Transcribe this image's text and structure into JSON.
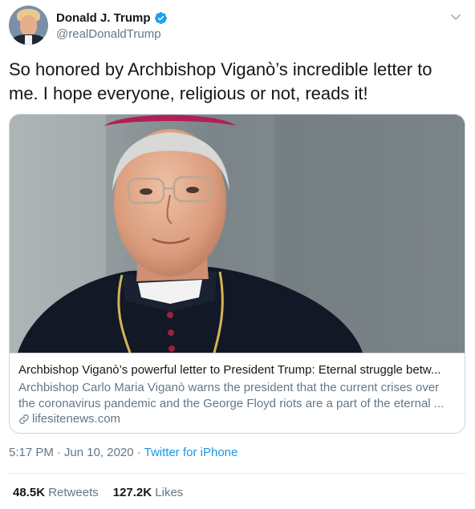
{
  "author": {
    "name": "Donald J. Trump",
    "handle": "@realDonaldTrump",
    "verified": true
  },
  "tweet": {
    "text": "So honored by Archbishop Viganò’s incredible letter to me. I hope everyone, religious or not, reads it!"
  },
  "card": {
    "title": "Archbishop Viganò’s powerful letter to President Trump: Eternal struggle betw...",
    "description_line1": "Archbishop Carlo Maria Viganò warns the president that the current crises over",
    "description_line2": "the coronavirus pandemic and the George Floyd riots are a part of the eternal ...",
    "domain": "lifesitenews.com"
  },
  "meta": {
    "time": "5:17 PM",
    "separator1": "·",
    "date": "Jun 10, 2020",
    "separator2": "·",
    "source": "Twitter for iPhone"
  },
  "stats": {
    "retweets_count": "48.5K",
    "retweets_label": "Retweets",
    "likes_count": "127.2K",
    "likes_label": "Likes"
  },
  "colors": {
    "link": "#1b95e0",
    "secondary_text": "#657786",
    "verified": "#1da1f2"
  },
  "icons": [
    "verified-badge-icon",
    "chevron-down-icon",
    "link-icon"
  ]
}
